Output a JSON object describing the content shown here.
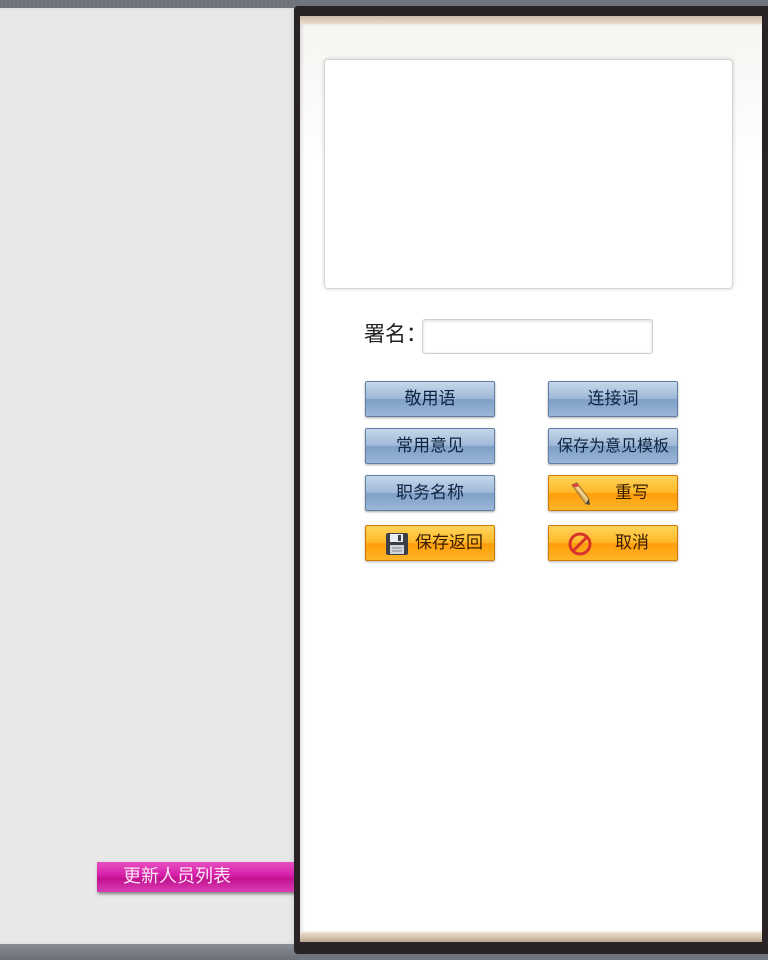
{
  "left_panel": {
    "update_button_label": "更新人员列表"
  },
  "form": {
    "opinion_text": "",
    "signature_label": "署名：",
    "signature_value": ""
  },
  "buttons": {
    "greeting": "敬用语",
    "connector": "连接词",
    "common_opinion": "常用意见",
    "save_as_template": "保存为意见模板",
    "job_title": "职务名称",
    "rewrite": "重写",
    "save_return": "保存返回",
    "cancel": "取消"
  },
  "icons": {
    "rewrite": "pencil-icon",
    "save_return": "floppy-disk-icon",
    "cancel": "no-entry-icon"
  },
  "colors": {
    "left_button": "#d51ea8",
    "blue_button": "#9fb9d8",
    "orange_button": "#ffb92a"
  }
}
